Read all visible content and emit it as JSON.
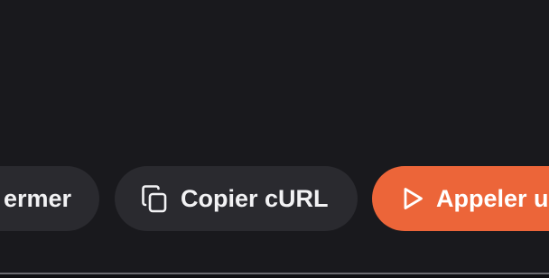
{
  "actions": {
    "close_label": "ermer",
    "copy_curl_label": "Copier cURL",
    "call_label": "Appeler u"
  },
  "icons": {
    "copy": "copy-icon",
    "play": "play-icon"
  },
  "colors": {
    "background": "#19191d",
    "secondary_button": "#2a2a2f",
    "accent": "#ec6539",
    "text": "#f2f2f4"
  }
}
